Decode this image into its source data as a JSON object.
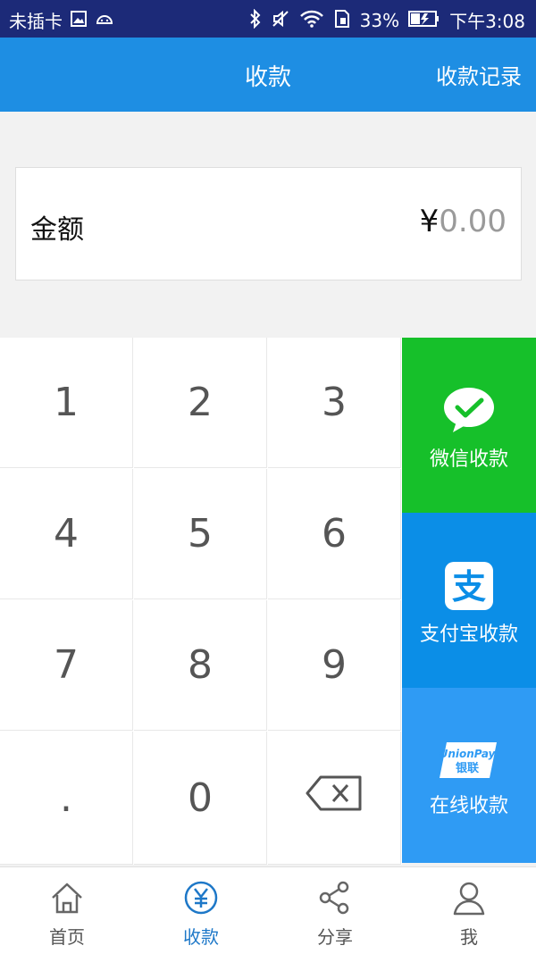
{
  "status_bar": {
    "carrier": "未插卡",
    "battery": "33%",
    "time": "下午3:08"
  },
  "header": {
    "title": "收款",
    "records_link": "收款记录"
  },
  "amount": {
    "label": "金额",
    "currency": "¥",
    "value": "0.00"
  },
  "keypad": {
    "keys": [
      "1",
      "2",
      "3",
      "4",
      "5",
      "6",
      "7",
      "8",
      "9",
      ".",
      "0"
    ]
  },
  "payments": [
    {
      "label": "微信收款",
      "color": "#16c02a",
      "icon": "wechat-pay-icon"
    },
    {
      "label": "支付宝收款",
      "color": "#0b8ee7",
      "icon": "alipay-icon"
    },
    {
      "label": "在线收款",
      "color": "#2f9bf4",
      "icon": "unionpay-icon"
    }
  ],
  "unionpay_logo": {
    "line1": "UnionPay",
    "line2": "银联"
  },
  "nav": {
    "items": [
      {
        "label": "首页",
        "icon": "home-icon"
      },
      {
        "label": "收款",
        "icon": "yuan-icon"
      },
      {
        "label": "分享",
        "icon": "share-icon"
      },
      {
        "label": "我",
        "icon": "user-icon"
      }
    ],
    "active": "收款"
  },
  "colors": {
    "status_bar": "#1c2a78",
    "app_bar": "#1e8ee3",
    "nav_active": "#1e78c8"
  }
}
